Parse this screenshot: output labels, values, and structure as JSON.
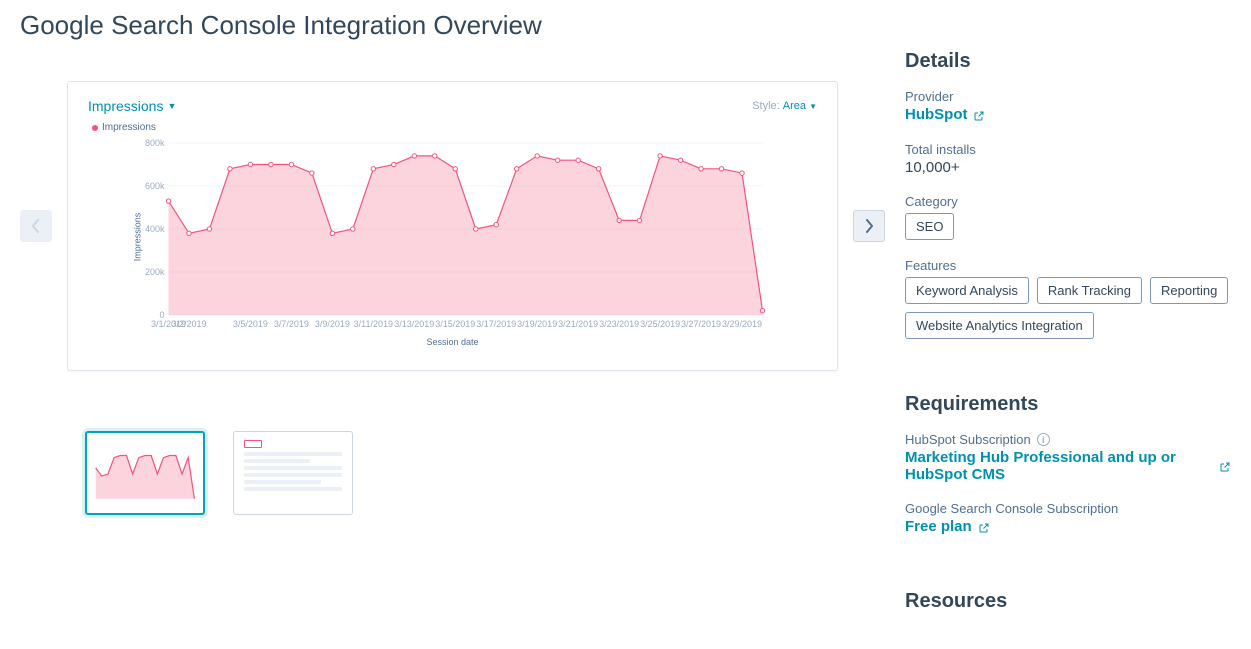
{
  "page_title": "Google Search Console Integration Overview",
  "carousel": {
    "chart_header_metric": "Impressions",
    "style_label": "Style:",
    "style_value": "Area",
    "legend_label": "Impressions",
    "xlabel": "Session date"
  },
  "chart_data": {
    "type": "area",
    "title": "Impressions",
    "xlabel": "Session date",
    "ylabel": "Impressions",
    "ylim": [
      0,
      800000
    ],
    "y_ticks": [
      "0",
      "200k",
      "400k",
      "600k",
      "800k"
    ],
    "x_ticks": [
      "3/1/2019",
      "3/2/2019",
      "3/5/2019",
      "3/7/2019",
      "3/9/2019",
      "3/11/2019",
      "3/13/2019",
      "3/15/2019",
      "3/17/2019",
      "3/19/2019",
      "3/21/2019",
      "3/23/2019",
      "3/25/2019",
      "3/27/2019",
      "3/29/2019"
    ],
    "series": [
      {
        "name": "Impressions",
        "color": "#f2547d",
        "points": [
          {
            "x": "3/1/2019",
            "y": 530000
          },
          {
            "x": "3/2/2019",
            "y": 380000
          },
          {
            "x": "3/3/2019",
            "y": 400000
          },
          {
            "x": "3/4/2019",
            "y": 680000
          },
          {
            "x": "3/5/2019",
            "y": 700000
          },
          {
            "x": "3/6/2019",
            "y": 700000
          },
          {
            "x": "3/7/2019",
            "y": 700000
          },
          {
            "x": "3/8/2019",
            "y": 660000
          },
          {
            "x": "3/9/2019",
            "y": 380000
          },
          {
            "x": "3/10/2019",
            "y": 400000
          },
          {
            "x": "3/11/2019",
            "y": 680000
          },
          {
            "x": "3/12/2019",
            "y": 700000
          },
          {
            "x": "3/13/2019",
            "y": 740000
          },
          {
            "x": "3/14/2019",
            "y": 740000
          },
          {
            "x": "3/15/2019",
            "y": 680000
          },
          {
            "x": "3/16/2019",
            "y": 400000
          },
          {
            "x": "3/17/2019",
            "y": 420000
          },
          {
            "x": "3/18/2019",
            "y": 680000
          },
          {
            "x": "3/19/2019",
            "y": 740000
          },
          {
            "x": "3/20/2019",
            "y": 720000
          },
          {
            "x": "3/21/2019",
            "y": 720000
          },
          {
            "x": "3/22/2019",
            "y": 680000
          },
          {
            "x": "3/23/2019",
            "y": 440000
          },
          {
            "x": "3/24/2019",
            "y": 440000
          },
          {
            "x": "3/25/2019",
            "y": 740000
          },
          {
            "x": "3/26/2019",
            "y": 720000
          },
          {
            "x": "3/27/2019",
            "y": 680000
          },
          {
            "x": "3/28/2019",
            "y": 680000
          },
          {
            "x": "3/29/2019",
            "y": 660000
          },
          {
            "x": "3/30/2019",
            "y": 20000
          }
        ]
      }
    ]
  },
  "details": {
    "heading": "Details",
    "provider_label": "Provider",
    "provider_value": "HubSpot",
    "installs_label": "Total installs",
    "installs_value": "10,000+",
    "category_label": "Category",
    "category_tags": [
      "SEO"
    ],
    "features_label": "Features",
    "features_tags": [
      "Keyword Analysis",
      "Rank Tracking",
      "Reporting",
      "Website Analytics Integration"
    ]
  },
  "requirements": {
    "heading": "Requirements",
    "hubspot_sub_label": "HubSpot Subscription",
    "hubspot_sub_value": "Marketing Hub Professional and up or HubSpot CMS",
    "google_sub_label": "Google Search Console Subscription",
    "google_sub_value": "Free plan"
  },
  "resources": {
    "heading": "Resources"
  }
}
